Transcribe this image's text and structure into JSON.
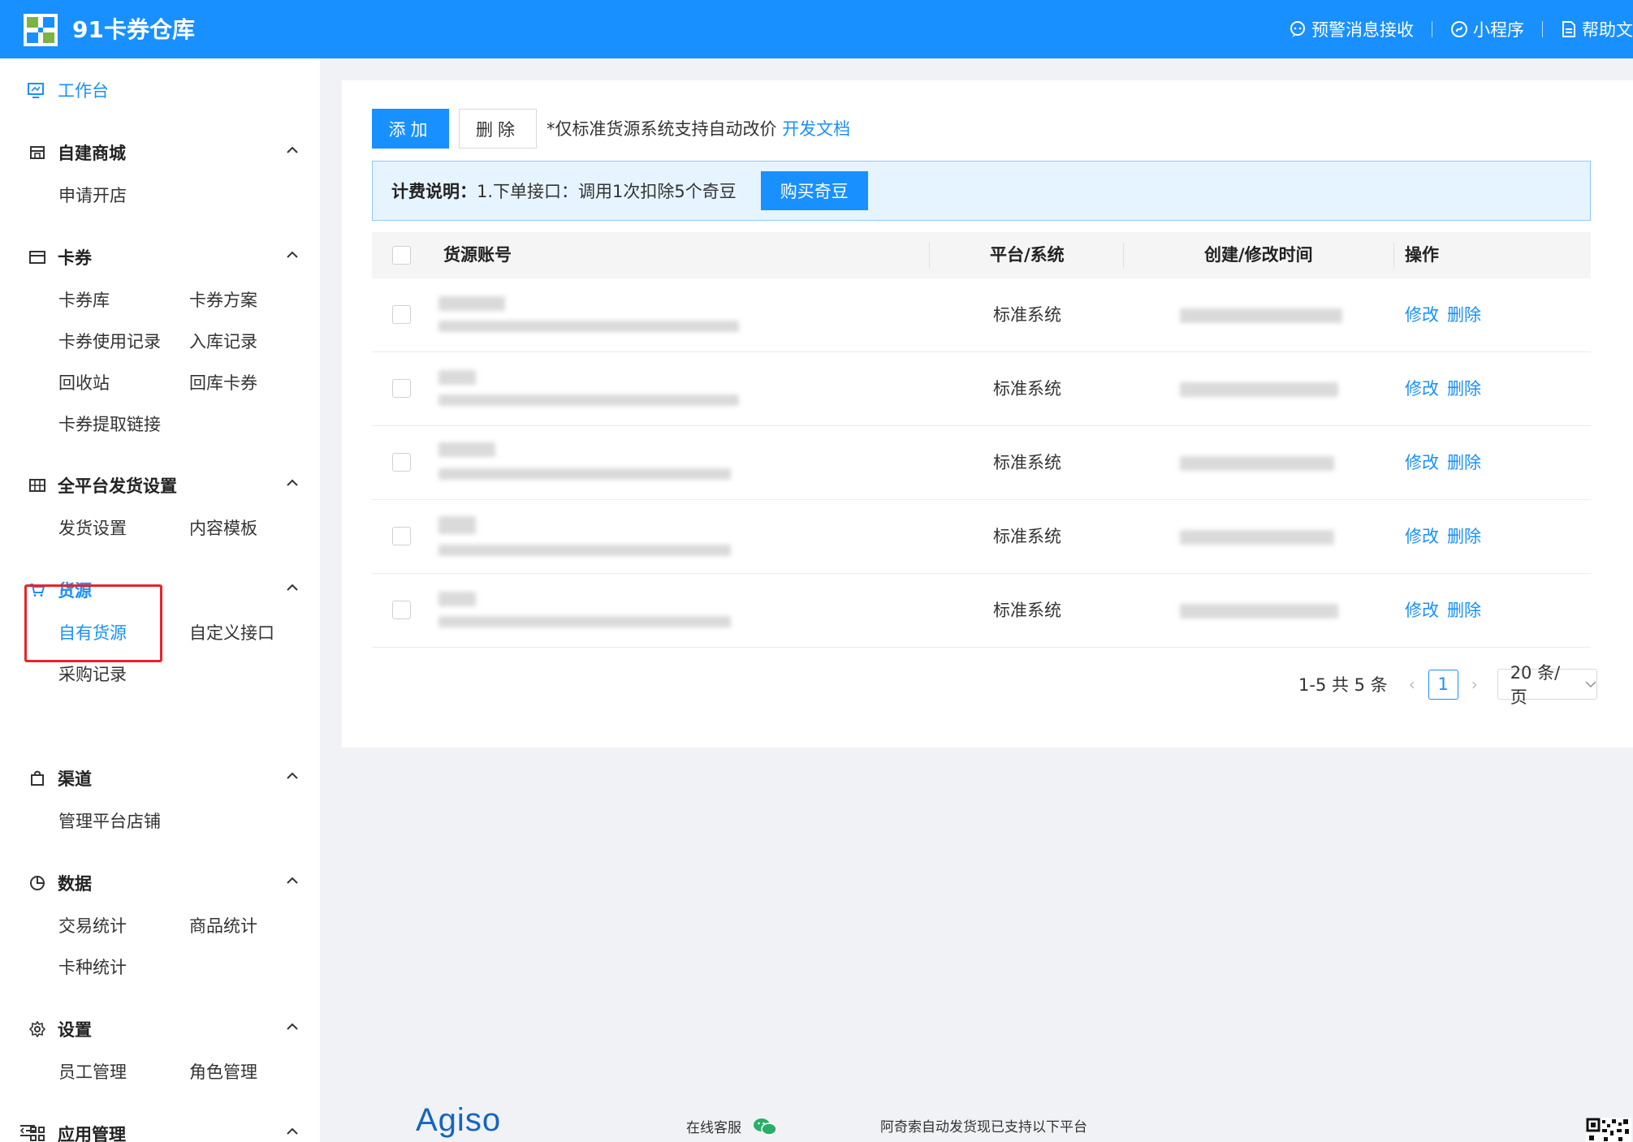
{
  "app": {
    "title": "91卡券仓库"
  },
  "header": {
    "links": [
      {
        "label": "预警消息接收",
        "icon": "bell-chat-icon"
      },
      {
        "label": "小程序",
        "icon": "mini-program-icon"
      },
      {
        "label": "帮助文",
        "icon": "document-icon"
      }
    ]
  },
  "sidebar": {
    "dashboard": "工作台",
    "groups": [
      {
        "title": "自建商城",
        "items": [
          "申请开店"
        ]
      },
      {
        "title": "卡券",
        "items": [
          "卡券库",
          "卡券方案",
          "卡券使用记录",
          "入库记录",
          "回收站",
          "回库卡券",
          "卡券提取链接"
        ]
      },
      {
        "title": "全平台发货设置",
        "items": [
          "发货设置",
          "内容模板"
        ]
      },
      {
        "title": "货源",
        "items": [
          "自有货源",
          "自定义接口",
          "采购记录"
        ]
      },
      {
        "title": "渠道",
        "items": [
          "管理平台店铺"
        ]
      },
      {
        "title": "数据",
        "items": [
          "交易统计",
          "商品统计",
          "卡种统计"
        ]
      },
      {
        "title": "设置",
        "items": [
          "员工管理",
          "角色管理"
        ]
      },
      {
        "title": "应用管理",
        "items": []
      }
    ]
  },
  "toolbar": {
    "add_label": "添加",
    "delete_label": "删除",
    "hint": "*仅标准货源系统支持自动改价",
    "hint_link": "开发文档"
  },
  "notice": {
    "label": "计费说明：",
    "text": "1.下单接口：调用1次扣除5个奇豆",
    "button": "购买奇豆"
  },
  "table": {
    "columns": [
      "货源账号",
      "平台/系统",
      "创建/修改时间",
      "操作"
    ],
    "rows": [
      {
        "platform": "标准系统",
        "edit": "修改",
        "delete": "删除"
      },
      {
        "platform": "标准系统",
        "edit": "修改",
        "delete": "删除"
      },
      {
        "platform": "标准系统",
        "edit": "修改",
        "delete": "删除"
      },
      {
        "platform": "标准系统",
        "edit": "修改",
        "delete": "删除"
      },
      {
        "platform": "标准系统",
        "edit": "修改",
        "delete": "删除"
      }
    ]
  },
  "pagination": {
    "summary": "1-5 共 5 条",
    "current_page": "1",
    "page_size": "20 条/页"
  },
  "footer": {
    "brand": "Agiso",
    "customer_service": "在线客服",
    "platforms_text": "阿奇索自动发货现已支持以下平台"
  },
  "colors": {
    "primary": "#1890ff",
    "highlight_box": "#e8232c"
  }
}
